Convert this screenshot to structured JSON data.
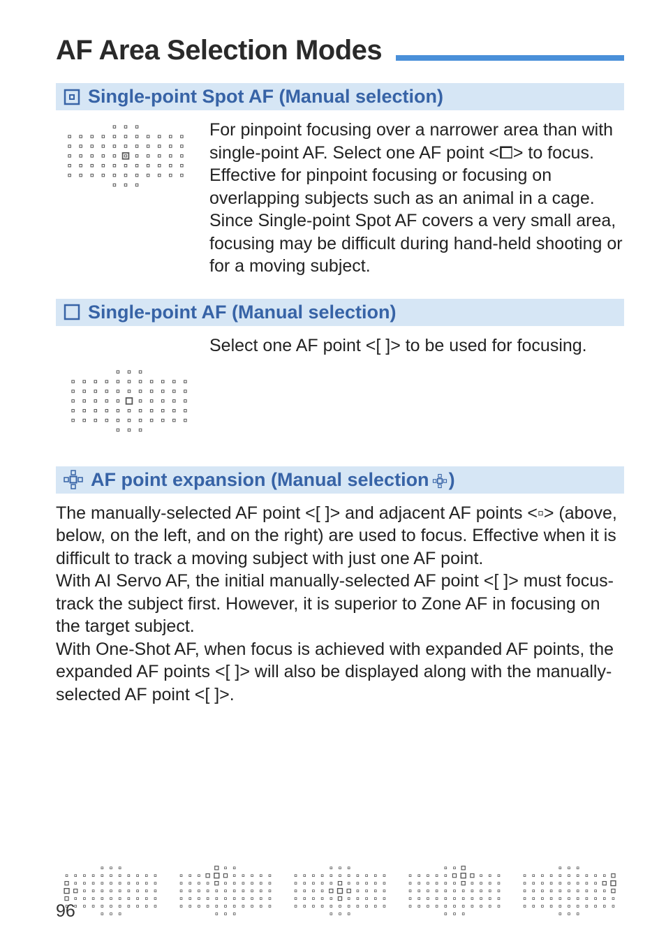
{
  "page_title": "AF Area Selection Modes",
  "page_number": "96",
  "sections": [
    {
      "icon_name": "single-point-spot-icon",
      "heading": "Single-point Spot AF (Manual selection)",
      "body": "For pinpoint focusing over a narrower area than with single-point AF. Select one AF point <⧠> to focus.\nEffective for pinpoint focusing or focusing on overlapping subjects such as an animal in a cage. Since Single-point Spot AF covers a very small area, focusing may be difficult during hand-held shooting or for a moving subject."
    },
    {
      "icon_name": "single-point-icon",
      "heading": "Single-point AF (Manual selection)",
      "body": "Select one AF point <[ ]> to be used for focusing."
    },
    {
      "icon_name": "af-expansion-icon",
      "heading": "AF point expansion (Manual selection",
      "heading_tail": ")",
      "body": "The manually-selected AF point <[ ]> and adjacent AF points <▫> (above, below, on the left, and on the right) are used to focus. Effective when it is difficult to track a moving subject with just one AF point.\nWith AI Servo AF, the initial manually-selected AF point <[ ]> must focus-track the subject first. However, it is superior to Zone AF in focusing on the target subject.\nWith One-Shot AF, when focus is achieved with expanded AF points, the expanded AF points <[ ]> will also be displayed along with the manually-selected AF point <[ ]>."
    }
  ]
}
